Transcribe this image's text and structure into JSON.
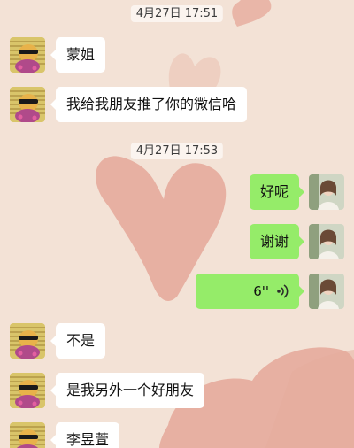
{
  "chat": {
    "timestamps": {
      "t1": "4月27日 17:51",
      "t2": "4月27日 17:53"
    },
    "messages": [
      {
        "side": "in",
        "text": "蒙姐"
      },
      {
        "side": "in",
        "text": "我给我朋友推了你的微信哈"
      },
      {
        "side": "out",
        "text": "好呢"
      },
      {
        "side": "out",
        "text": "谢谢"
      },
      {
        "side": "out",
        "type": "voice",
        "duration": "6''",
        "icon": "voice-wave-icon"
      },
      {
        "side": "in",
        "text": "不是"
      },
      {
        "side": "in",
        "text": "是我另外一个好朋友"
      },
      {
        "side": "in",
        "text": "李昱萱"
      }
    ]
  },
  "colors": {
    "background": "#f3e2d6",
    "heart": "#e6ab9c",
    "outgoing_bubble": "#95ec69",
    "incoming_bubble": "#ffffff"
  },
  "avatars": {
    "contact": "cartoon-character-avatar",
    "self": "woman-photo-avatar"
  }
}
